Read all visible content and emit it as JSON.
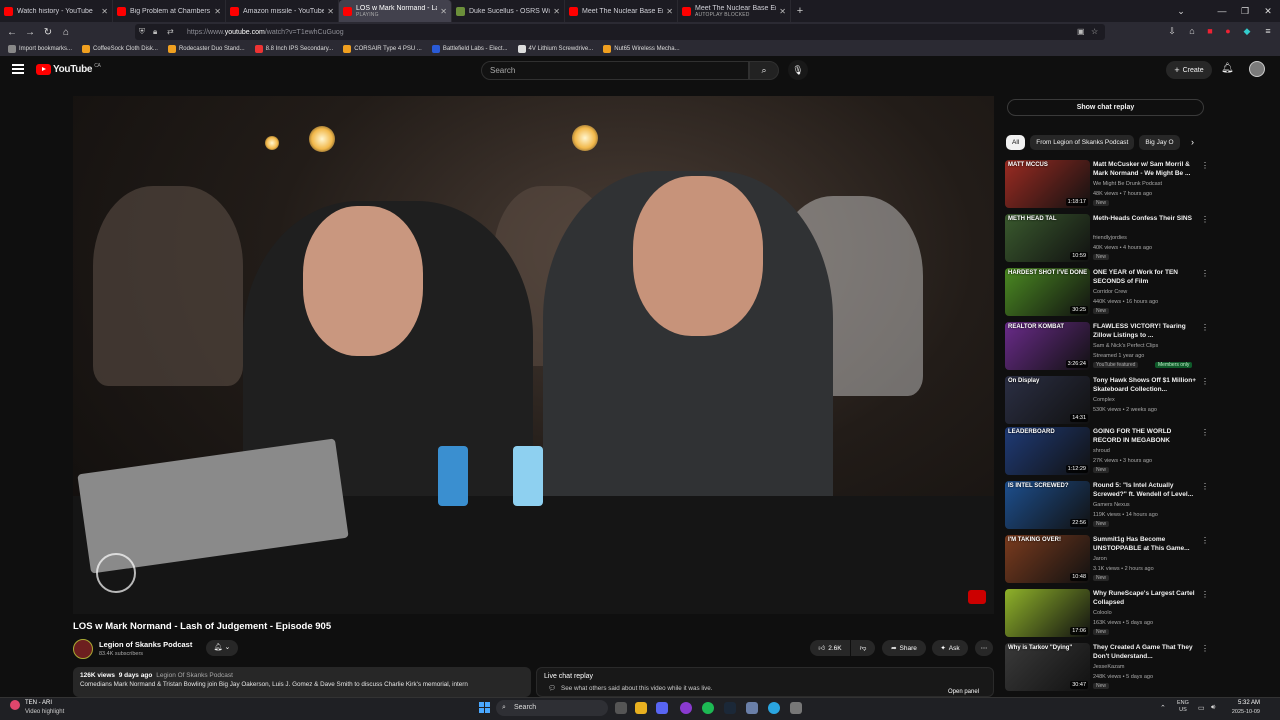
{
  "tabs": [
    {
      "title": "Watch history - YouTube",
      "active": false
    },
    {
      "title": "Big Problem at Chambers - YouTube",
      "active": false
    },
    {
      "title": "Amazon missile - YouTube",
      "active": false
    },
    {
      "title": "LOS w Mark Normand - Lash of Judgement",
      "active": true,
      "status": "PLAYING"
    },
    {
      "title": "Duke Sucellus - OSRS Wiki",
      "active": false
    },
    {
      "title": "Meet The Nuclear Base Employees",
      "active": false
    },
    {
      "title": "Meet The Nuclear Base Employees",
      "active": false,
      "status": "AUTOPLAY BLOCKED"
    }
  ],
  "url": {
    "prefix": "https://www.",
    "domain": "youtube.com",
    "path": "/watch?v=T1ewhCuGuog"
  },
  "bookmarks": [
    "Import bookmarks...",
    "CoffeeSock Cloth Disk...",
    "Rodecaster Duo Stand...",
    "8.8 Inch IPS Secondary...",
    "CORSAIR Type 4 PSU ...",
    "Battlefield Labs - Elect...",
    "4V Lithium Screwdrive...",
    "Nut65 Wireless Mecha..."
  ],
  "youtube": {
    "logo": "YouTube",
    "region": "CA",
    "search_placeholder": "Search",
    "create_label": "Create"
  },
  "video": {
    "title": "LOS w Mark Normand - Lash of Judgement - Episode 905",
    "channel": "Legion of Skanks Podcast",
    "subscribers": "83.4K subscribers",
    "likes": "2.6K",
    "share": "Share",
    "ask": "Ask",
    "views": "126K views",
    "age": "9 days ago",
    "desc_tag": "Legion Of Skanks Podcast",
    "description": "Comedians Mark Normand & Tristan Bowling join Big Jay Oakerson, Luis J. Gomez & Dave Smith to discuss Charlie Kirk's memorial, intern"
  },
  "live_chat": {
    "heading": "Live chat replay",
    "subtext": "See what others said about this video while it was live.",
    "open_panel": "Open panel"
  },
  "sidebar": {
    "show_chat_replay": "Show chat replay",
    "chips": [
      "All",
      "From Legion of Skanks Podcast",
      "Big Jay O"
    ],
    "recommendations": [
      {
        "title": "Matt McCusker w/ Sam Morril & Mark Normand - We Might Be ...",
        "channel": "We Might Be Drunk Podcast",
        "views": "48K views • 7 hours ago",
        "badge": "New",
        "duration": "1:18:17",
        "thumb_text": "MATT MCCUS",
        "color": "#9b2b22"
      },
      {
        "title": "Meth-Heads Confess Their SINS",
        "channel": "friendlyjordies",
        "views": "40K views • 4 hours ago",
        "badge": "New",
        "duration": "10:59",
        "thumb_text": "METH HEAD TAL",
        "color": "#3a5a2e"
      },
      {
        "title": "ONE YEAR of Work for TEN SECONDS of Film",
        "channel": "Corridor Crew",
        "views": "440K views • 16 hours ago",
        "badge": "New",
        "duration": "30:25",
        "thumb_text": "HARDEST SHOT I'VE DONE",
        "color": "#4b8a22"
      },
      {
        "title": "FLAWLESS VICTORY! Tearing Zillow Listings to ...",
        "channel": "Sam & Nick's Perfect Clips",
        "views": "Streamed 1 year ago",
        "badge": "YouTube featured",
        "members": "Members only",
        "duration": "3:26:24",
        "thumb_text": "REALTOR KOMBAT",
        "color": "#6a2b8a"
      },
      {
        "title": "Tony Hawk Shows Off $1 Million+ Skateboard Collection...",
        "channel": "Complex",
        "views": "530K views • 2 weeks ago",
        "badge": "",
        "duration": "14:31",
        "thumb_text": "On Display",
        "color": "#2b2f44"
      },
      {
        "title": "GOING FOR THE WORLD RECORD IN MEGABONK",
        "channel": "shroud",
        "views": "27K views • 3 hours ago",
        "badge": "New",
        "duration": "1:12:29",
        "thumb_text": "LEADERBOARD",
        "color": "#1f3b77"
      },
      {
        "title": "Round 5: \"Is Intel Actually Screwed?\" ft. Wendell of Level...",
        "channel": "Gamers Nexus",
        "views": "119K views • 14 hours ago",
        "badge": "New",
        "duration": "22:56",
        "thumb_text": "IS INTEL SCREWED?",
        "color": "#1d4f8e"
      },
      {
        "title": "Summit1g Has Become UNSTOPPABLE at This Game...",
        "channel": "Jaron",
        "views": "3.1K views • 2 hours ago",
        "badge": "New",
        "duration": "10:48",
        "thumb_text": "I'M TAKING OVER!",
        "color": "#7a3b1e"
      },
      {
        "title": "Why RuneScape's Largest Cartel Collapsed",
        "channel": "Coloolo",
        "views": "163K views • 5 days ago",
        "badge": "New",
        "duration": "17:06",
        "thumb_text": "",
        "color": "#8fb22a"
      },
      {
        "title": "They Created A Game That They Don't Understand...",
        "channel": "JesseKazam",
        "views": "248K views • 5 days ago",
        "badge": "New",
        "duration": "30:47",
        "thumb_text": "Why is Tarkov \"Dying\"",
        "color": "#3a3a3a"
      }
    ]
  },
  "taskbar": {
    "weather_line1": "TEN - ARI",
    "weather_line2": "Video highlight",
    "search": "Search",
    "lang": "ENG",
    "lang2": "US",
    "time": "5:32 AM",
    "date": "2025-10-09"
  },
  "colors": {
    "brand": "#ff0000",
    "bg": "#0f0f0f",
    "firefox_tab": "#1c1b22"
  }
}
